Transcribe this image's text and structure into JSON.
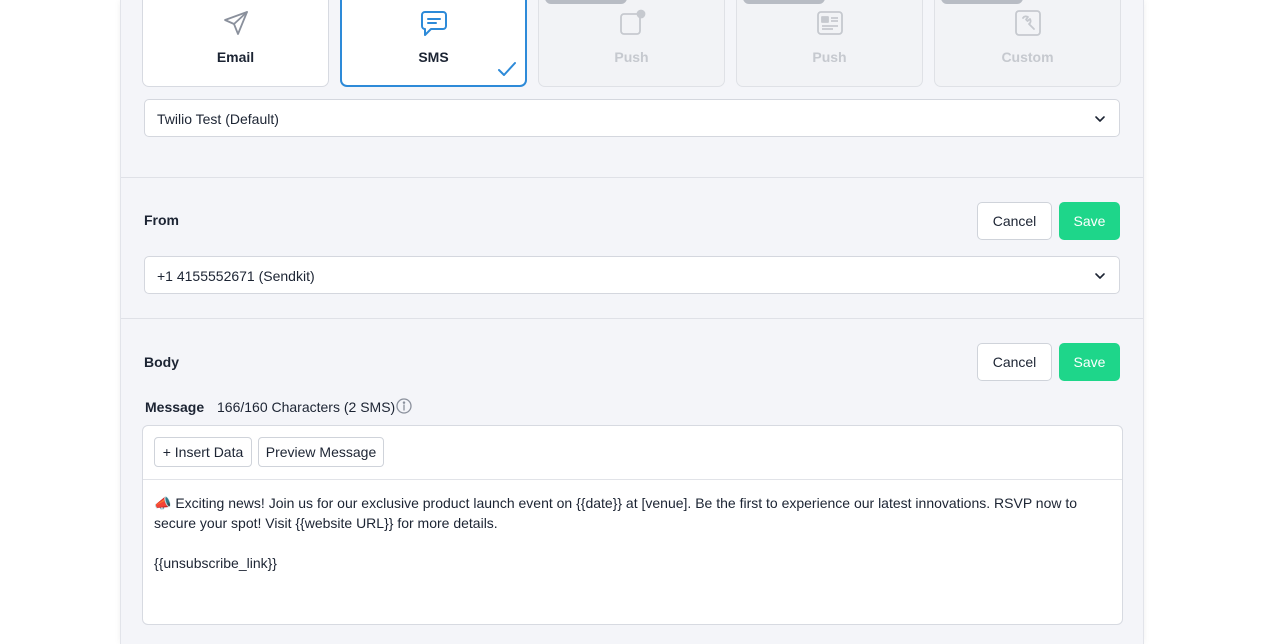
{
  "channels": [
    {
      "label": "Email",
      "icon": "paper-plane-icon",
      "state": "normal"
    },
    {
      "label": "SMS",
      "icon": "chat-bubble-icon",
      "state": "selected"
    },
    {
      "label": "Push",
      "icon": "mobile-notification-icon",
      "state": "disabled"
    },
    {
      "label": "Push",
      "icon": "in-app-message-icon",
      "state": "disabled"
    },
    {
      "label": "Custom",
      "icon": "wrench-icon",
      "state": "disabled"
    }
  ],
  "provider": {
    "value": "Twilio Test (Default)"
  },
  "from": {
    "title": "From",
    "cancel_label": "Cancel",
    "save_label": "Save",
    "value": "+1 4155552671 (Sendkit)"
  },
  "body": {
    "title": "Body",
    "cancel_label": "Cancel",
    "save_label": "Save",
    "message_label": "Message",
    "char_count": "166/160 Characters (2 SMS)",
    "insert_data_label": "+ Insert Data",
    "preview_label": "Preview Message",
    "message_line1": "📣 Exciting news! Join us for our exclusive product launch event on {{date}} at [venue]. Be the first to experience our latest innovations. RSVP now to secure your spot! Visit {{website URL}} for more details.",
    "message_line2": "{{unsubscribe_link}}"
  },
  "colors": {
    "accent": "#2d8ad8",
    "save": "#1ed68a",
    "panel_bg": "#f4f5f9"
  }
}
